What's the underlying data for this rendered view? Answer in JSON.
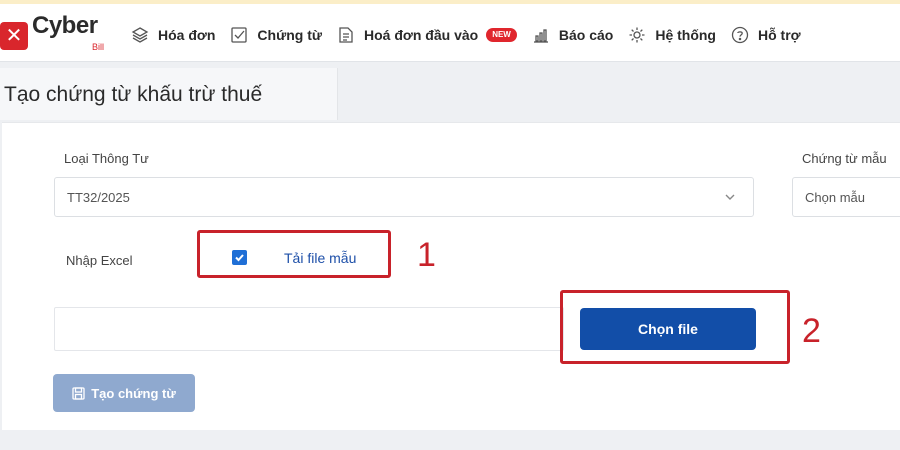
{
  "app": {
    "brand": "Cyber",
    "brand_sub": "Bill"
  },
  "nav": {
    "items": [
      {
        "label": "Hóa đơn",
        "icon": "layers-icon"
      },
      {
        "label": "Chứng từ",
        "icon": "checklist-icon"
      },
      {
        "label": "Hoá đơn đầu vào",
        "icon": "document-icon",
        "badge": "NEW"
      },
      {
        "label": "Báo cáo",
        "icon": "chart-icon"
      },
      {
        "label": "Hệ thống",
        "icon": "gear-icon"
      },
      {
        "label": "Hỗ trợ",
        "icon": "help-icon"
      }
    ]
  },
  "page": {
    "title": "Tạo chứng từ khấu trừ thuế"
  },
  "form": {
    "circular_label": "Loại Thông Tư",
    "circular_value": "TT32/2025",
    "template_label": "Chứng từ mẫu",
    "template_value": "Chọn mẫu",
    "import_label": "Nhập Excel",
    "download_template_link": "Tải file mẫu",
    "choose_file_button": "Chọn file",
    "create_button": "Tạo chứng từ"
  },
  "annotations": {
    "step1": "1",
    "step2": "2"
  },
  "colors": {
    "brand_red": "#d9262c",
    "primary_blue": "#124ea8",
    "annotation_red": "#c8222a",
    "create_button_disabled": "#8fa9cf"
  }
}
